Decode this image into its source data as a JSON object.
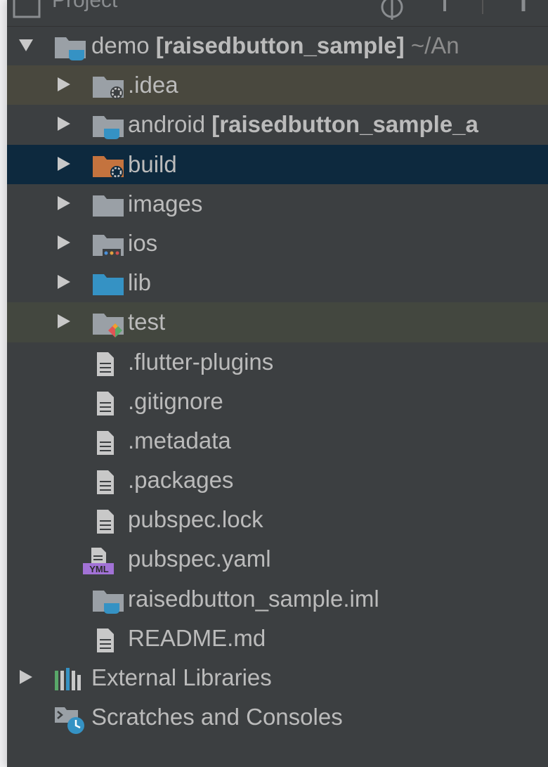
{
  "panel": {
    "title": "Project"
  },
  "tree": {
    "root": {
      "name": "demo",
      "module": "[raisedbutton_sample]",
      "path": "~/An"
    },
    "folders": [
      {
        "name": ".idea"
      },
      {
        "name": "android",
        "module": "[raisedbutton_sample_a"
      },
      {
        "name": "build"
      },
      {
        "name": "images"
      },
      {
        "name": "ios"
      },
      {
        "name": "lib"
      },
      {
        "name": "test"
      }
    ],
    "files": [
      {
        "name": ".flutter-plugins"
      },
      {
        "name": ".gitignore"
      },
      {
        "name": ".metadata"
      },
      {
        "name": ".packages"
      },
      {
        "name": "pubspec.lock"
      },
      {
        "name": "pubspec.yaml",
        "badge": "YML"
      },
      {
        "name": "raisedbutton_sample.iml"
      },
      {
        "name": "README.md"
      }
    ],
    "external_libraries": "External Libraries",
    "scratches": "Scratches and Consoles"
  },
  "colors": {
    "panel_bg": "#3c3f41",
    "text": "#bbbbbb",
    "path_text": "#8c8c8c",
    "selected_row": "#0d293e",
    "idea_row": "#49483e",
    "test_row": "#43473f",
    "folder_gray": "#9aa0a6",
    "module_blue": "#3592c4",
    "excluded_orange": "#c4733e"
  }
}
